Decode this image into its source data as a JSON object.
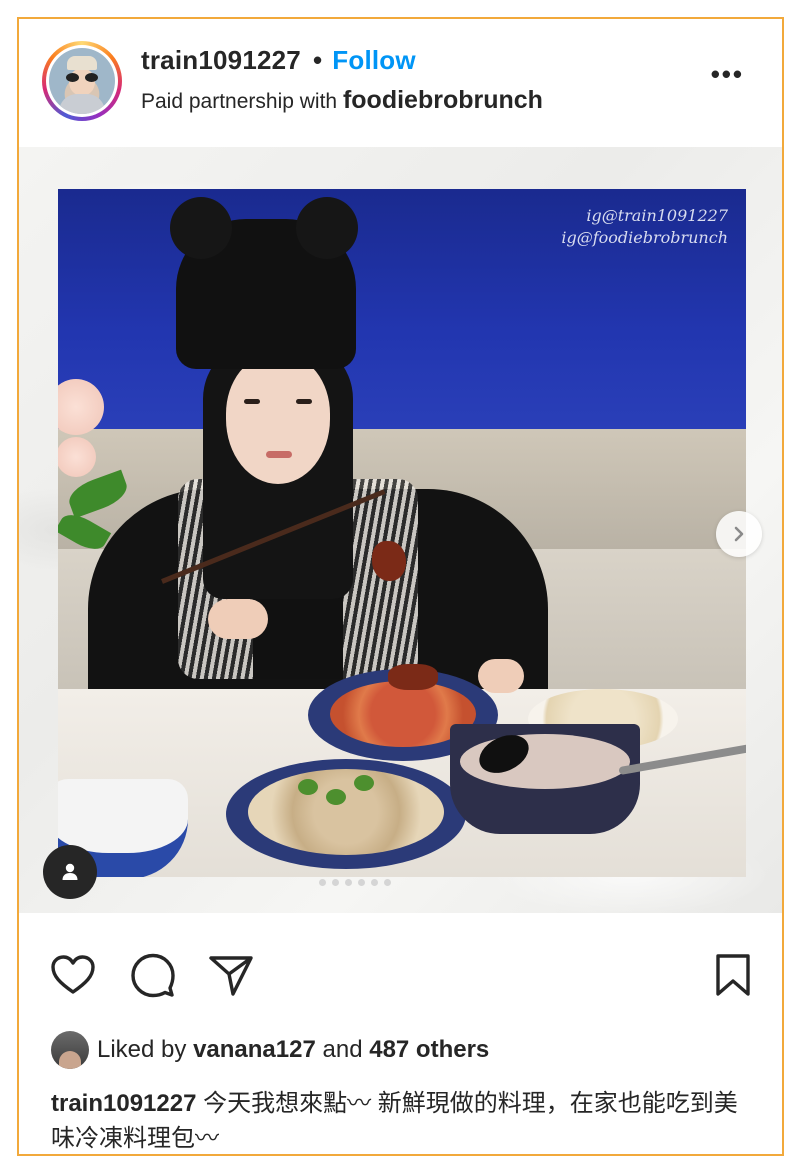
{
  "post": {
    "username": "train1091227",
    "separator": "•",
    "follow_label": "Follow",
    "partnership_prefix": "Paid partnership with",
    "partner_name": "foodiebrobrunch",
    "more_label": "•••"
  },
  "media": {
    "watermark_line1": "ig@train1091227",
    "watermark_line2": "ig@foodiebrobrunch"
  },
  "likes": {
    "prefix": "Liked by",
    "liker": "vanana127",
    "conjunction": "and",
    "others": "487 others"
  },
  "caption": {
    "username": "train1091227",
    "text": "今天我想來點〰 新鮮現做的料理，在家也能吃到美味冷凍料理包〰"
  },
  "icons": {
    "like": "heart-icon",
    "comment": "comment-icon",
    "share": "send-icon",
    "save": "bookmark-icon",
    "next": "chevron-right-icon",
    "tag": "person-tag-icon"
  },
  "colors": {
    "follow": "#0095f6",
    "frame_border": "#f2a93b",
    "text": "#262626"
  }
}
